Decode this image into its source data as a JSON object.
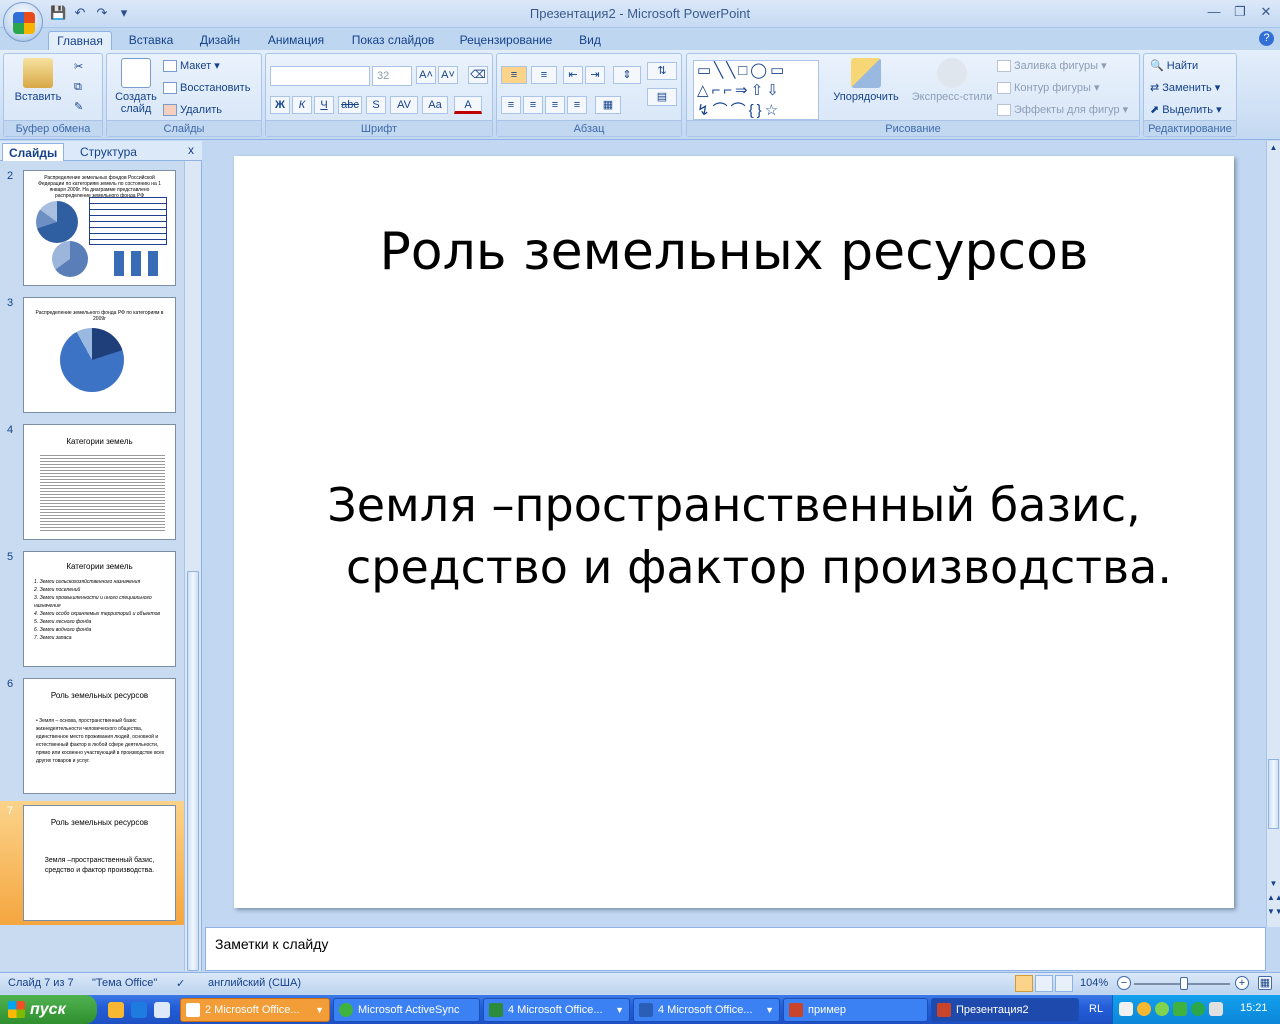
{
  "window": {
    "title": "Презентация2 - Microsoft PowerPoint",
    "controls": [
      "minimize",
      "restore",
      "close"
    ]
  },
  "tabs": [
    {
      "label": "Главная",
      "active": true
    },
    {
      "label": "Вставка"
    },
    {
      "label": "Дизайн"
    },
    {
      "label": "Анимация"
    },
    {
      "label": "Показ слайдов"
    },
    {
      "label": "Рецензирование"
    },
    {
      "label": "Вид"
    }
  ],
  "ribbon": {
    "clipboard": {
      "label": "Буфер обмена",
      "paste": "Вставить"
    },
    "slides": {
      "label": "Слайды",
      "new_slide": "Создать слайд",
      "layout": "Макет",
      "reset": "Восстановить",
      "delete": "Удалить"
    },
    "font": {
      "label": "Шрифт",
      "font_name": "",
      "font_size": "32",
      "bold": "Ж",
      "italic": "К",
      "underline": "Ч",
      "strike": "abc",
      "shadow": "S",
      "spacing": "AV",
      "case": "Aa",
      "color": "A"
    },
    "paragraph": {
      "label": "Абзац"
    },
    "drawing": {
      "label": "Рисование",
      "arrange": "Упорядочить",
      "quick_styles": "Экспресс-стили",
      "fill": "Заливка фигуры",
      "outline": "Контур фигуры",
      "effects": "Эффекты для фигур"
    },
    "editing": {
      "label": "Редактирование",
      "find": "Найти",
      "replace": "Заменить",
      "select": "Выделить"
    }
  },
  "slides_pane": {
    "tabs": [
      "Слайды",
      "Структура"
    ],
    "close": "x",
    "thumbnails": [
      {
        "number": "2",
        "title": "Распределение земельных фондов Российской Федерации по категориям земель по состоянию на 1 января 2009г. На диаграмме представлено распределение земельного фонда РФ"
      },
      {
        "number": "3",
        "title": "Распределение земельного фонда РФ по категориям в 2009г"
      },
      {
        "number": "4",
        "title": "Категории земель"
      },
      {
        "number": "5",
        "title": "Категории земель",
        "items": [
          "Земли сельскохозяйственного назначения",
          "Земли поселений",
          "Земли промышленности и иного специального назначения",
          "Земли особо охраняемых территорий и объектов",
          "Земли лесного фонда",
          "Земли водного фонда",
          "Земли запаса"
        ]
      },
      {
        "number": "6",
        "title": "Роль земельных ресурсов",
        "body": "Земля – основа, пространственный базис жизнедеятельности человеческого общества, единственное место проживания людей, основной и естественный фактор в любой сфере деятельности, прямо или косвенно участвующий в производстве всех других товаров и услуг."
      },
      {
        "number": "7",
        "title": "Роль земельных ресурсов",
        "body": "Земля –пространственный базис, средство и фактор производства.",
        "selected": true
      }
    ]
  },
  "slide": {
    "title": "Роль земельных ресурсов",
    "body_line1": "Земля –пространственный базис,",
    "body_line2": "средство и фактор производства."
  },
  "notes": {
    "placeholder": "Заметки к слайду"
  },
  "status": {
    "slide_counter": "Слайд 7 из 7",
    "theme": "\"Тема Office\"",
    "language": "английский (США)",
    "zoom": "104%"
  },
  "taskbar": {
    "start": "пуск",
    "tasks": [
      {
        "label": "2 Microsoft Office...",
        "style": "orange"
      },
      {
        "label": "Microsoft ActiveSync"
      },
      {
        "label": "4 Microsoft Office..."
      },
      {
        "label": "4 Microsoft Office..."
      },
      {
        "label": "пример"
      },
      {
        "label": "Презентация2",
        "active": true
      }
    ],
    "lang": "RL",
    "clock": "15:21"
  }
}
